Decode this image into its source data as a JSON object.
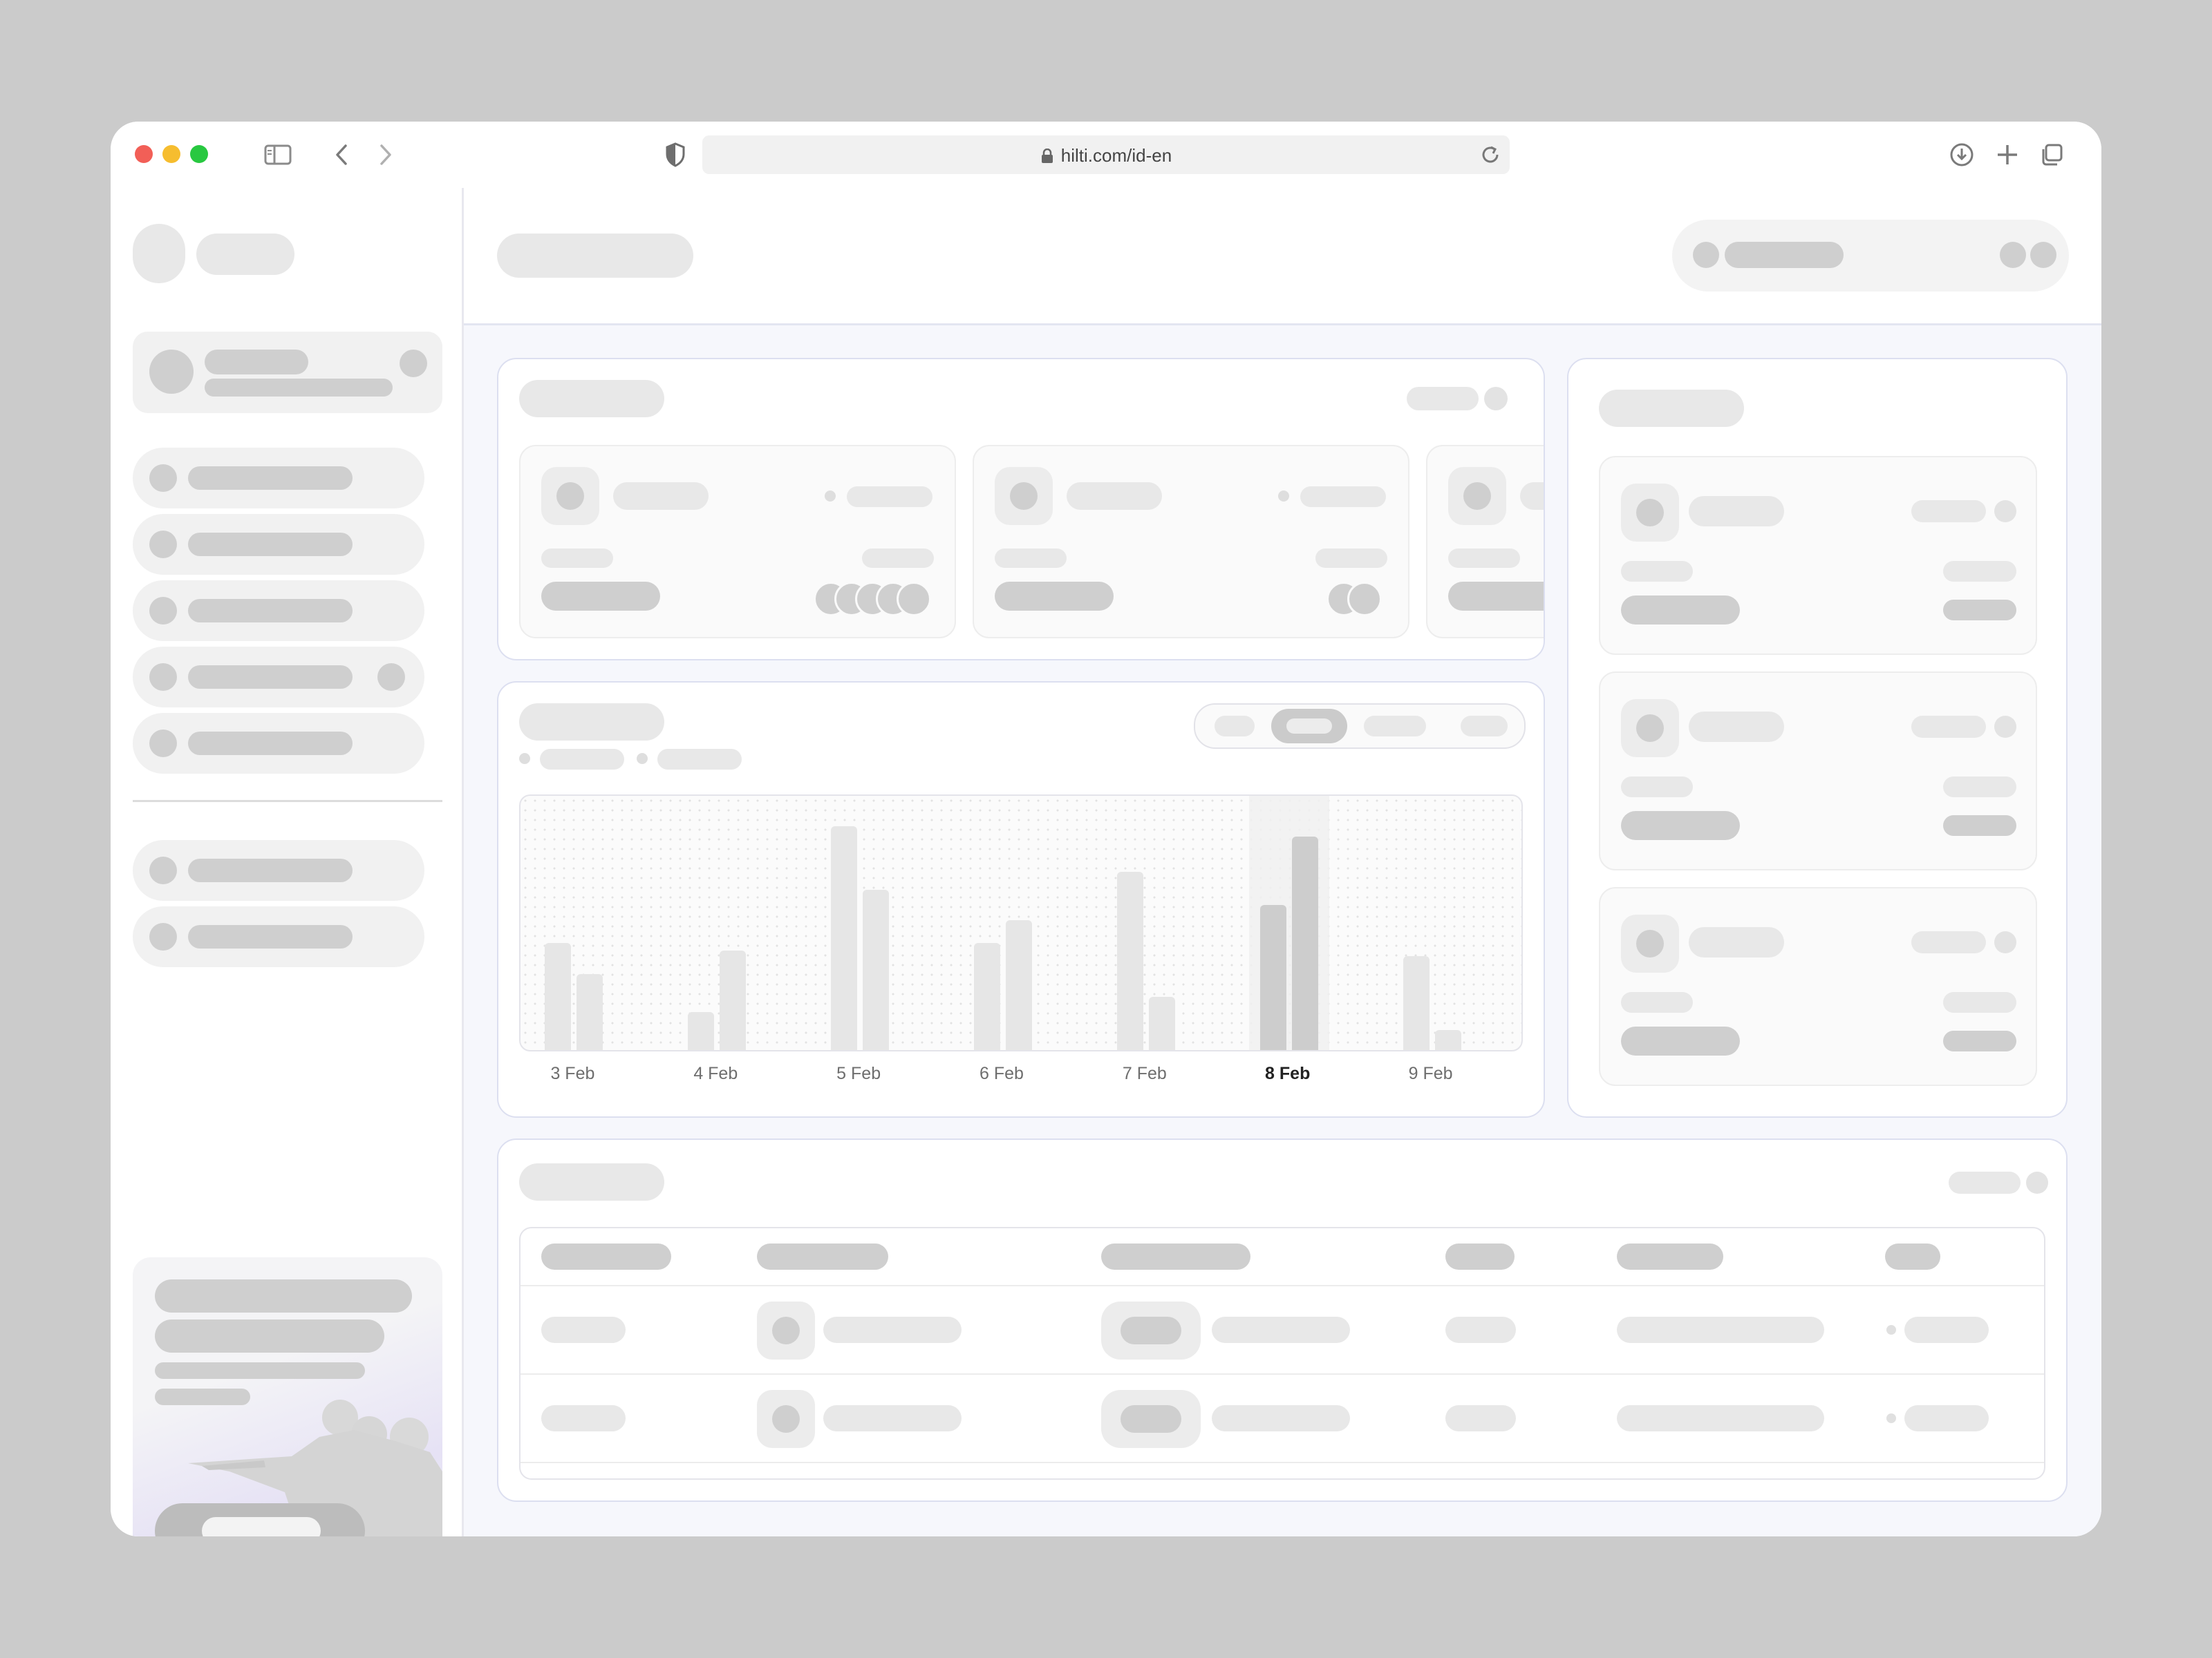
{
  "browser": {
    "url": "hilti.com/id-en",
    "icons": {
      "traffic": [
        "close-dot",
        "minimize-dot",
        "zoom-dot"
      ],
      "sidebar_toggle": "sidebar-toggle-icon",
      "back": "chevron-left-icon",
      "forward": "chevron-right-icon",
      "shield": "shield-icon",
      "lock": "lock-icon",
      "reload": "reload-icon",
      "download": "download-icon",
      "new_tab": "plus-icon",
      "tabs": "tabs-icon"
    },
    "colors": {
      "close": "#f25f57",
      "minimize": "#f6bd2f",
      "zoom": "#28c840"
    }
  },
  "chart_data": {
    "type": "bar",
    "categories": [
      "3 Feb",
      "4 Feb",
      "5 Feb",
      "6 Feb",
      "7 Feb",
      "8 Feb",
      "9 Feb"
    ],
    "series": [
      {
        "values": [
          42,
          15,
          88,
          42,
          70,
          57,
          37
        ]
      },
      {
        "values": [
          30,
          39,
          63,
          51,
          21,
          84,
          8
        ]
      }
    ],
    "ylim": [
      0,
      100
    ],
    "highlighted_category": "8 Feb",
    "grid": "dotted",
    "colors": {
      "bar": "#e6e6e6",
      "bar_highlight": "#cdcdcd",
      "column_highlight": "#f1f1f1"
    }
  },
  "chart_labels": [
    "3 Feb",
    "4 Feb",
    "5 Feb",
    "6 Feb",
    "7 Feb",
    "8 Feb",
    "9 Feb"
  ]
}
